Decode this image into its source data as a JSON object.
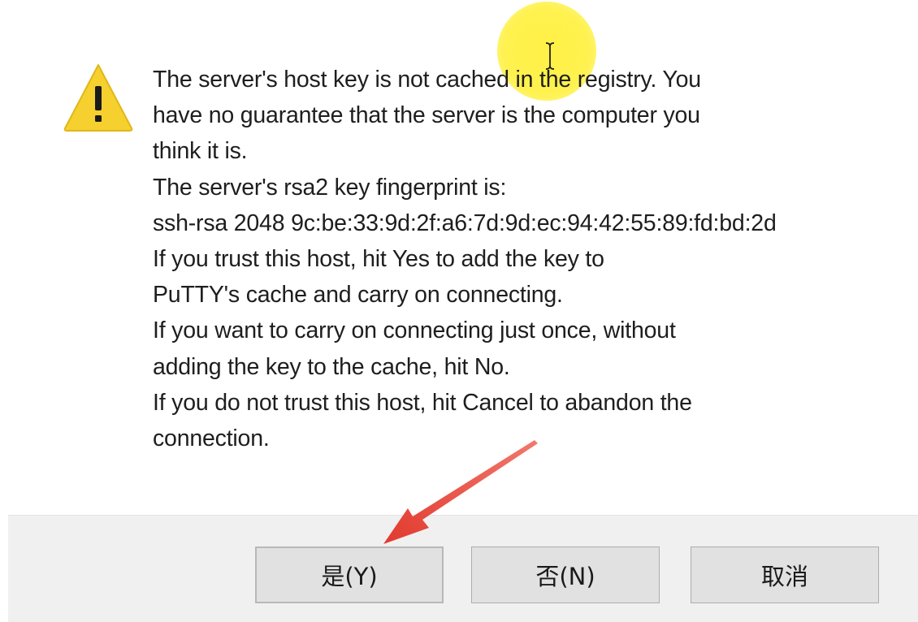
{
  "dialog": {
    "message_lines": [
      "The server's host key is not cached in the registry. You",
      "have no guarantee that the server is the computer you",
      "think it is.",
      "The server's rsa2 key fingerprint is:",
      "ssh-rsa 2048 9c:be:33:9d:2f:a6:7d:9d:ec:94:42:55:89:fd:bd:2d",
      "If you trust this host, hit Yes to add the key to",
      "PuTTY's cache and carry on connecting.",
      "If you want to carry on connecting just once, without",
      "adding the key to the cache, hit No.",
      "If you do not trust this host, hit Cancel to abandon the",
      "connection."
    ],
    "icon": "warning-icon"
  },
  "buttons": {
    "yes_label": "是(Y)",
    "no_label": "否(N)",
    "cancel_label": "取消"
  },
  "annotation": {
    "arrow_color": "#e8463a",
    "highlight_color": "#fff03c"
  }
}
